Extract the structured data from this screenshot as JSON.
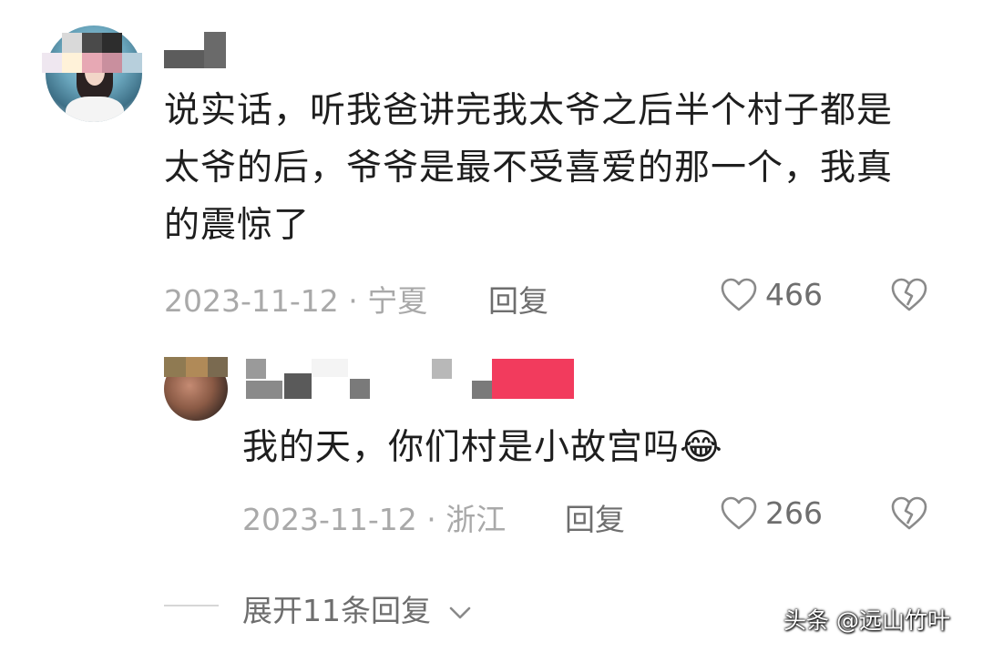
{
  "comments": [
    {
      "text": "说实话，听我爸讲完我太爷之后半个村子都是太爷的后，爷爷是最不受喜爱的那一个，我真的震惊了",
      "date": "2023-11-12 · 宁夏",
      "reply_label": "回复",
      "likes": "466"
    },
    {
      "text": "我的天，你们村是小故宫吗",
      "emoji": "😂",
      "date": "2023-11-12 · 浙江",
      "reply_label": "回复",
      "likes": "266"
    }
  ],
  "expand_replies_label": "展开11条回复",
  "watermark": "头条 @远山竹叶",
  "icons": {
    "like": "heart-outline-icon",
    "dislike": "broken-heart-icon",
    "expand": "chevron-down-icon"
  },
  "colors": {
    "text": "#1e1e1e",
    "meta": "#a9a9a9",
    "action": "#6e6e6e",
    "redaction_pink": "#f23b5d"
  }
}
